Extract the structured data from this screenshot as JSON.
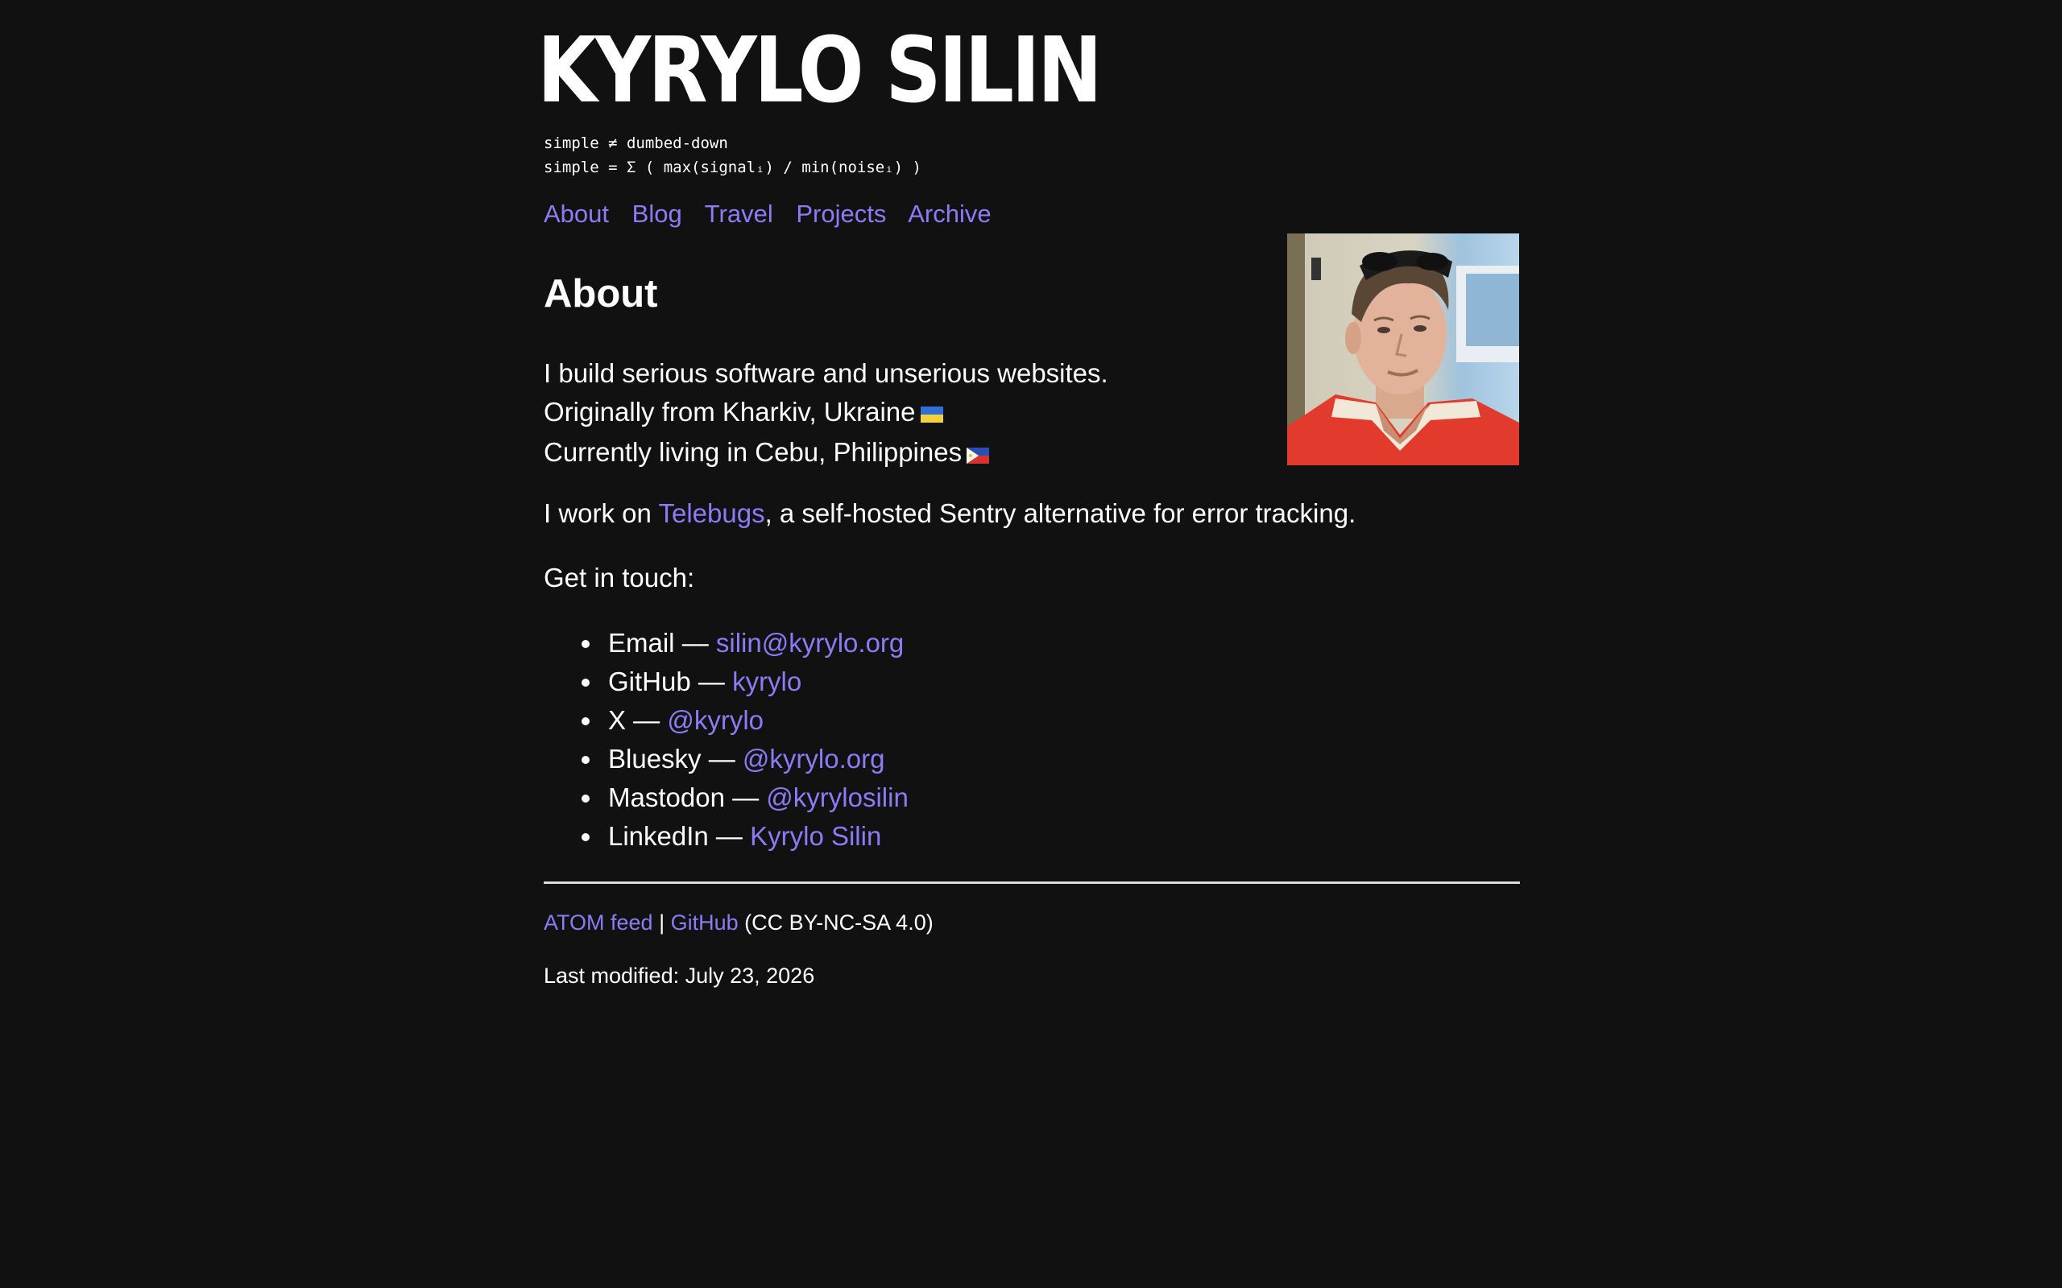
{
  "site": {
    "title": "KYRYLO SILIN",
    "motto_line1": "simple ≠ dumbed-down",
    "motto_line2": "simple = Σ ( max(signalᵢ) / min(noiseᵢ) )"
  },
  "nav": {
    "items": [
      {
        "label": "About"
      },
      {
        "label": "Blog"
      },
      {
        "label": "Travel"
      },
      {
        "label": "Projects"
      },
      {
        "label": "Archive"
      }
    ]
  },
  "page": {
    "heading": "About",
    "intro": [
      {
        "text": "I build serious software and unserious websites."
      },
      {
        "text": "Originally from Kharkiv, Ukraine",
        "flag": "ukraine-flag"
      },
      {
        "text": "Currently living in Cebu, Philippines",
        "flag": "philippines-flag"
      }
    ],
    "work": {
      "prefix": "I work on ",
      "link": "Telebugs",
      "suffix": ", a self-hosted Sentry alternative for error tracking."
    },
    "touch_label": "Get in touch:",
    "contacts": [
      {
        "label": "Email",
        "sep": " — ",
        "link": "silin@kyrylo.org"
      },
      {
        "label": "GitHub",
        "sep": " — ",
        "link": "kyrylo"
      },
      {
        "label": "X",
        "sep": " — ",
        "link": "@kyrylo"
      },
      {
        "label": "Bluesky",
        "sep": " — ",
        "link": "@kyrylo.org"
      },
      {
        "label": "Mastodon",
        "sep": " — ",
        "link": "@kyrylosilin"
      },
      {
        "label": "LinkedIn",
        "sep": " — ",
        "link": "Kyrylo Silin"
      }
    ]
  },
  "footer": {
    "feed_link": "ATOM feed",
    "divider": " | ",
    "github_link": "GitHub",
    "license": " (CC BY-NC-SA 4.0)",
    "last_modified": "Last modified: July 23, 2026"
  },
  "colors": {
    "background": "#111111",
    "text": "#ffffff",
    "link": "#8b7cf6"
  }
}
